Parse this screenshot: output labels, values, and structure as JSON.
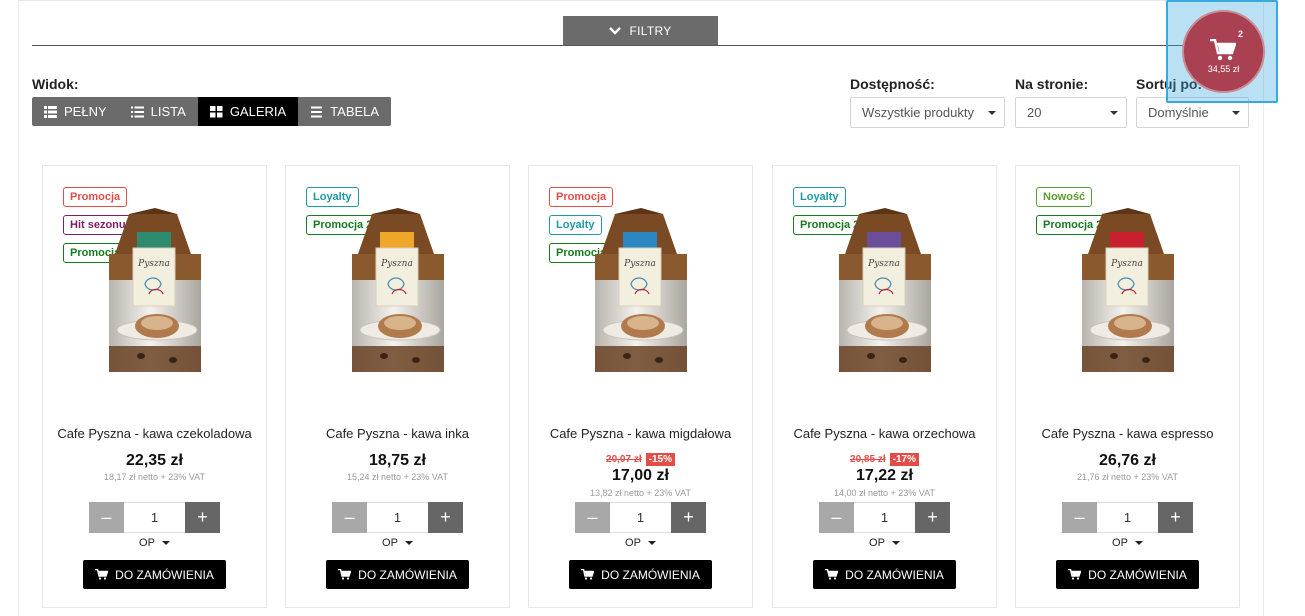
{
  "filters": {
    "toggle_label": "FILTRY"
  },
  "view": {
    "label": "Widok:",
    "options": [
      {
        "label": "PEŁNY",
        "icon": "list-thick-icon",
        "active": false
      },
      {
        "label": "LISTA",
        "icon": "list-icon",
        "active": false
      },
      {
        "label": "GALERIA",
        "icon": "grid-icon",
        "active": true
      },
      {
        "label": "TABELA",
        "icon": "table-icon",
        "active": false
      }
    ]
  },
  "availability": {
    "label": "Dostępność:",
    "value": "Wszystkie produkty"
  },
  "per_page": {
    "label": "Na stronie:",
    "value": "20"
  },
  "sort": {
    "label": "Sortuj po:",
    "value": "Domyślnie"
  },
  "cart": {
    "count": "2",
    "total": "34,55 zł",
    "color": "#a94152"
  },
  "colors": {
    "accent": "#a94152",
    "promo": "#e34d48",
    "loyalty": "#1d9aa5",
    "promo2": "#157c1e",
    "hit": "#7b1e64",
    "new": "#5b9b2e"
  },
  "products": [
    {
      "badges": [
        {
          "text": "Promocja",
          "type": "promo"
        },
        {
          "text": "Hit sezonu",
          "type": "hit"
        },
        {
          "text": "Promocja 2",
          "type": "promo2"
        }
      ],
      "label_color": "#2e8b6f",
      "name": "Cafe Pyszna - kawa czekoladowa",
      "old_price": "",
      "discount": "",
      "price": "22,35 zł",
      "netto": "18,17 zł netto + 23% VAT",
      "qty": "1",
      "unit": "OP",
      "button": "DO ZAMÓWIENIA"
    },
    {
      "badges": [
        {
          "text": "Loyalty",
          "type": "loyalty"
        },
        {
          "text": "Promocja 2",
          "type": "promo2"
        }
      ],
      "label_color": "#f0a52b",
      "name": "Cafe Pyszna - kawa inka",
      "old_price": "",
      "discount": "",
      "price": "18,75 zł",
      "netto": "15,24 zł netto + 23% VAT",
      "qty": "1",
      "unit": "OP",
      "button": "DO ZAMÓWIENIA"
    },
    {
      "badges": [
        {
          "text": "Promocja",
          "type": "promo"
        },
        {
          "text": "Loyalty",
          "type": "loyalty"
        },
        {
          "text": "Promocja 2",
          "type": "promo2"
        }
      ],
      "label_color": "#2b86c2",
      "name": "Cafe Pyszna - kawa migdałowa",
      "old_price": "20,07 zł",
      "discount": "-15%",
      "price": "17,00 zł",
      "netto": "13,82 zł netto + 23% VAT",
      "qty": "1",
      "unit": "OP",
      "button": "DO ZAMÓWIENIA"
    },
    {
      "badges": [
        {
          "text": "Loyalty",
          "type": "loyalty"
        },
        {
          "text": "Promocja 2",
          "type": "promo2"
        }
      ],
      "label_color": "#6a4e9a",
      "name": "Cafe Pyszna - kawa orzechowa",
      "old_price": "20,85 zł",
      "discount": "-17%",
      "price": "17,22 zł",
      "netto": "14,00 zł netto + 23% VAT",
      "qty": "1",
      "unit": "OP",
      "button": "DO ZAMÓWIENIA"
    },
    {
      "badges": [
        {
          "text": "Nowość",
          "type": "new"
        },
        {
          "text": "Promocja 2",
          "type": "promo2"
        }
      ],
      "label_color": "#c8202e",
      "name": "Cafe Pyszna - kawa espresso",
      "old_price": "",
      "discount": "",
      "price": "26,76 zł",
      "netto": "21,76 zł netto + 23% VAT",
      "qty": "1",
      "unit": "OP",
      "button": "DO ZAMÓWIENIA"
    }
  ]
}
